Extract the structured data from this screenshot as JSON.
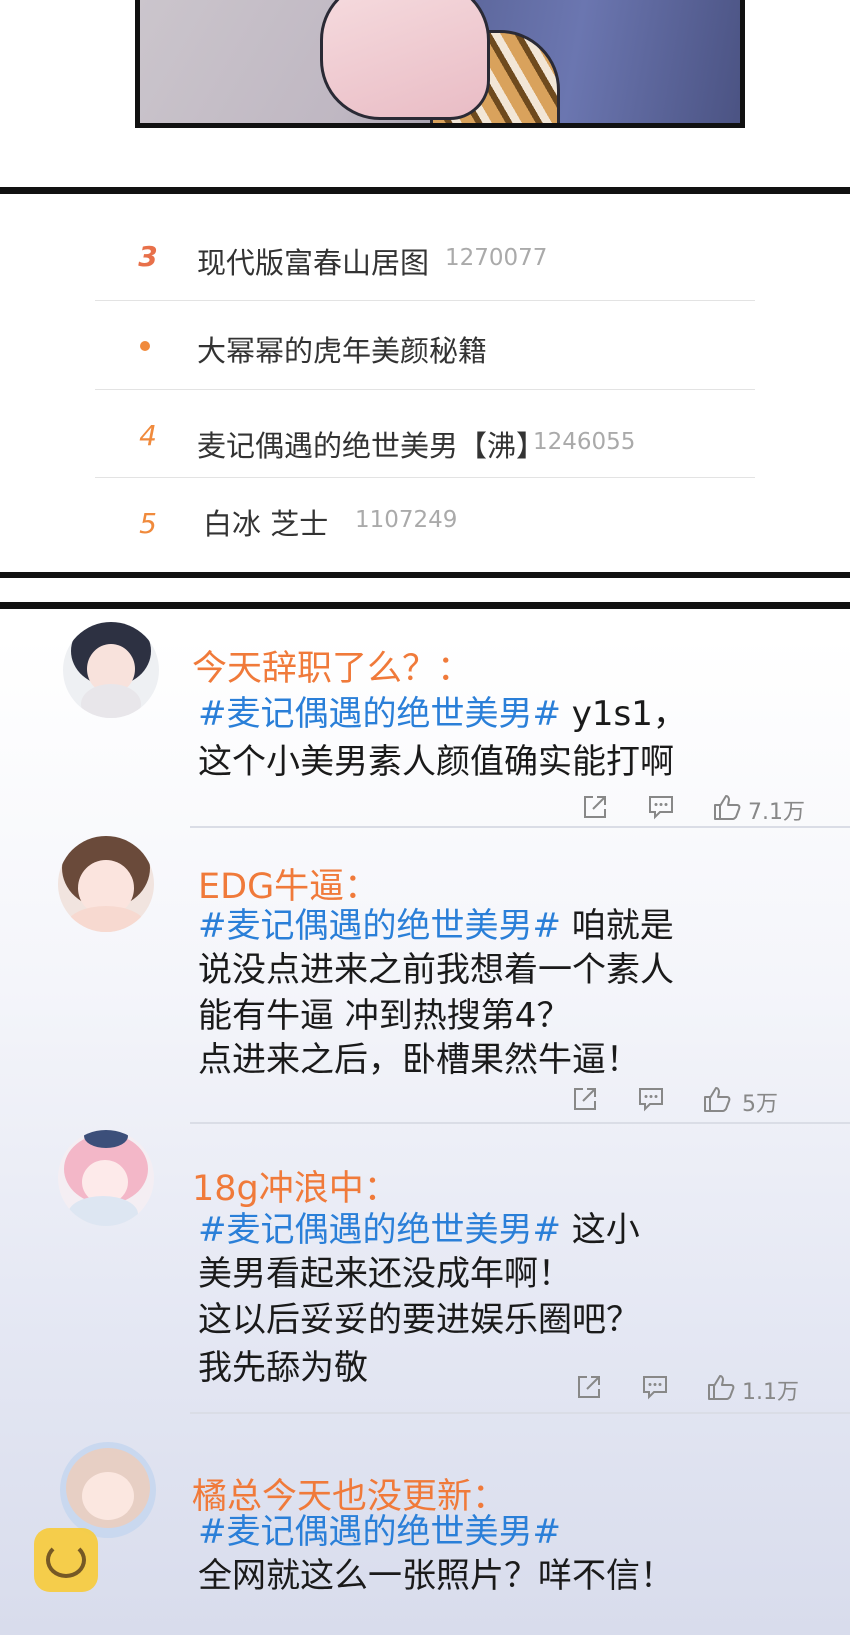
{
  "hot_search": {
    "items": [
      {
        "rank": "3",
        "title": "现代版富春山居图",
        "count": "1270077"
      },
      {
        "rank": "•",
        "title": "大幂幂的虎年美颜秘籍",
        "count": ""
      },
      {
        "rank": "4",
        "title": "麦记偶遇的绝世美男【沸】",
        "count": "1246055"
      },
      {
        "rank": "5",
        "title": "白冰 芝士",
        "count": "1107249"
      }
    ]
  },
  "comments": [
    {
      "username": "今天辞职了么？：",
      "hashtag": "#麦记偶遇的绝世美男#",
      "line1_rest": " y1s1，",
      "lines": [
        "这个小美男素人颜值确实能打啊"
      ],
      "likes": "7.1万"
    },
    {
      "username": "EDG牛逼：",
      "hashtag": "#麦记偶遇的绝世美男#",
      "line1_rest": " 咱就是",
      "lines": [
        "说没点进来之前我想着一个素人",
        "能有牛逼 冲到热搜第4？",
        "点进来之后，卧槽果然牛逼！"
      ],
      "likes": "5万"
    },
    {
      "username": "18g冲浪中：",
      "hashtag": "#麦记偶遇的绝世美男#",
      "line1_rest": " 这小",
      "lines": [
        "美男看起来还没成年啊！",
        "这以后妥妥的要进娱乐圈吧？",
        "我先舔为敬"
      ],
      "likes": "1.1万"
    },
    {
      "username": "橘总今天也没更新：",
      "hashtag": "#麦记偶遇的绝世美男#",
      "line1_rest": "",
      "lines": [
        "全网就这么一张照片？咩不信！"
      ],
      "likes": ""
    }
  ],
  "icons": {
    "share": "share-icon",
    "comment": "comment-icon",
    "like": "thumbs-up-icon"
  },
  "colors": {
    "rank": "#f08a3c",
    "username": "#f07a3a",
    "hashtag": "#2a7fd8"
  }
}
